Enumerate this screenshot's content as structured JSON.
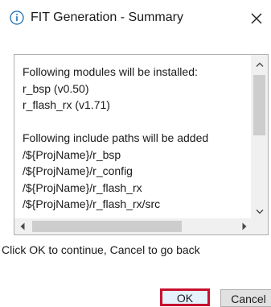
{
  "dialog": {
    "title": "FIT Generation - Summary",
    "info_icon": "info-icon",
    "close_icon": "close-icon"
  },
  "summary": {
    "lines": [
      "Following modules will be installed:",
      "r_bsp (v0.50)",
      "r_flash_rx (v1.71)",
      "",
      "Following include paths will be added",
      "/${ProjName}/r_bsp",
      "/${ProjName}/r_config",
      "/${ProjName}/r_flash_rx",
      "/${ProjName}/r_flash_rx/src"
    ]
  },
  "message": "Click OK to continue, Cancel to go back",
  "buttons": {
    "ok_label": "OK",
    "cancel_label": "Cancel"
  },
  "colors": {
    "highlight_border": "#c8102e",
    "info_icon": "#1a6fb5"
  }
}
